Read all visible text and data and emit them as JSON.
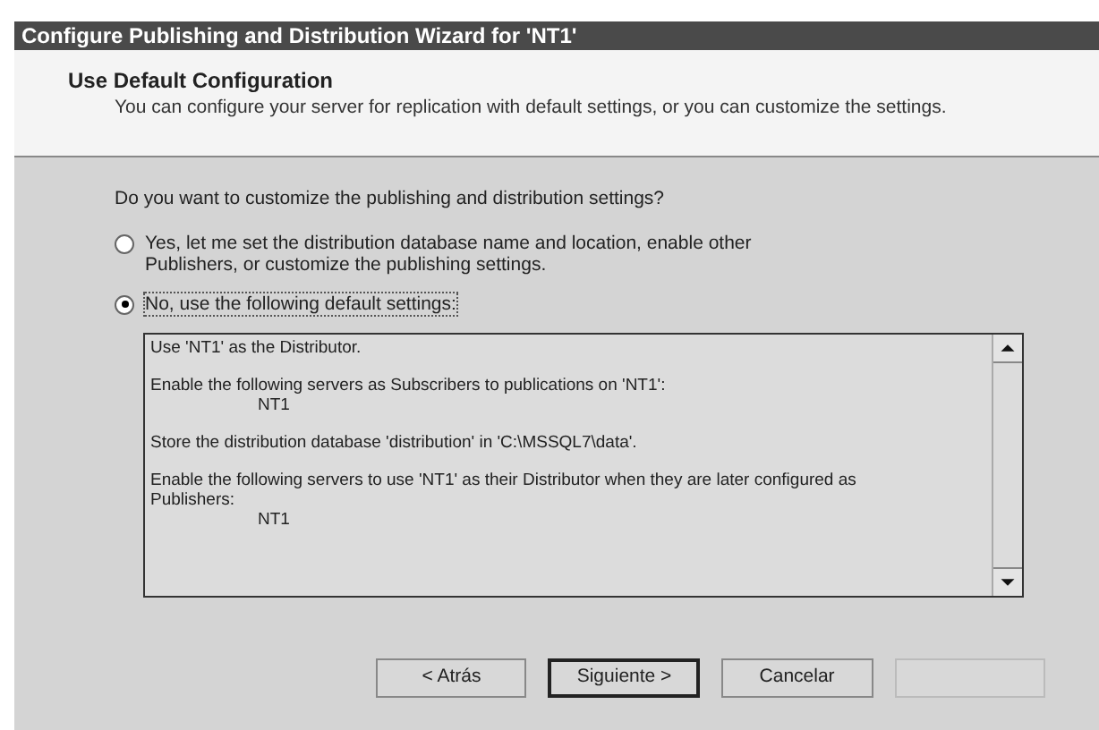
{
  "window": {
    "title": "Configure Publishing and Distribution Wizard for 'NT1'"
  },
  "header": {
    "title": "Use Default Configuration",
    "description": "You can configure your server for replication with default settings, or you can customize the settings."
  },
  "question": "Do you want to customize the publishing and distribution settings?",
  "options": [
    {
      "label": "Yes, let me set the distribution database name and location, enable other Publishers, or customize the publishing settings.",
      "selected": false
    },
    {
      "label": "No, use the following default settings:",
      "selected": true
    }
  ],
  "settings_list": [
    {
      "text": "Use 'NT1' as the Distributor."
    },
    {
      "text": "Enable the following servers as Subscribers to publications on 'NT1':",
      "value": "NT1"
    },
    {
      "text": "Store the distribution database 'distribution' in 'C:\\MSSQL7\\data'."
    },
    {
      "text": "Enable the following servers to use 'NT1' as their Distributor when they are later configured as Publishers:",
      "value": "NT1"
    }
  ],
  "buttons": [
    {
      "label": "< Atrás",
      "disabled": false,
      "default": false
    },
    {
      "label": "Siguiente >",
      "disabled": false,
      "default": true
    },
    {
      "label": "Cancelar",
      "disabled": false,
      "default": false
    },
    {
      "disabled": true,
      "default": false
    }
  ]
}
